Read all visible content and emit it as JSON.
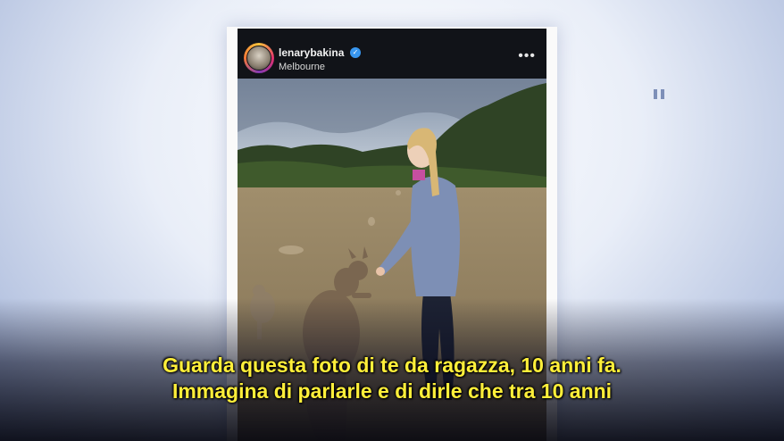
{
  "post": {
    "username": "lenarybakina",
    "location": "Melbourne",
    "verified_icon": "verified-badge-icon",
    "more_icon": "more-options-icon",
    "photo_description_icon": "post-photo"
  },
  "player": {
    "pause_icon": "pause-icon"
  },
  "subtitles": {
    "line1": "Guarda questa foto di te da ragazza, 10 anni fa.",
    "line2": "Immagina di parlarle e di dirle che tra 10 anni"
  },
  "colors": {
    "subtitle": "#ffef3a",
    "header_bg": "#111318",
    "verified": "#3897f0"
  }
}
